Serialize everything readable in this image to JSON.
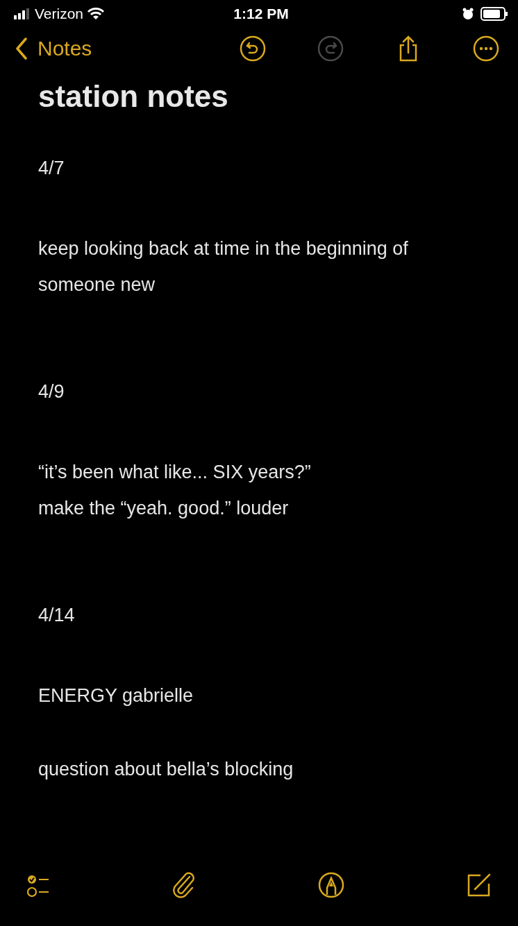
{
  "status_bar": {
    "carrier": "Verizon",
    "time": "1:12 PM"
  },
  "nav_bar": {
    "back_label": "Notes",
    "buttons": [
      {
        "kind": "undo",
        "disabled": false
      },
      {
        "kind": "redo",
        "disabled": true
      },
      {
        "kind": "share",
        "disabled": false
      },
      {
        "kind": "more",
        "disabled": false
      }
    ]
  },
  "note": {
    "title": "station notes",
    "sections": [
      {
        "date": "4/7",
        "paragraphs": [
          {
            "lines": [
              "keep looking back at time in the beginning of someone new"
            ]
          }
        ]
      },
      {
        "date": "4/9",
        "paragraphs": [
          {
            "lines": [
              "“it’s been what like... SIX years?”",
              "make the “yeah. good.” louder"
            ]
          }
        ]
      },
      {
        "date": "4/14",
        "paragraphs": [
          {
            "lines": [
              "ENERGY gabrielle"
            ]
          },
          {
            "lines": [
              "question about bella’s blocking"
            ]
          }
        ]
      }
    ]
  },
  "toolbar": [
    {
      "kind": "checklist"
    },
    {
      "kind": "attach"
    },
    {
      "kind": "markup"
    },
    {
      "kind": "compose"
    }
  ]
}
